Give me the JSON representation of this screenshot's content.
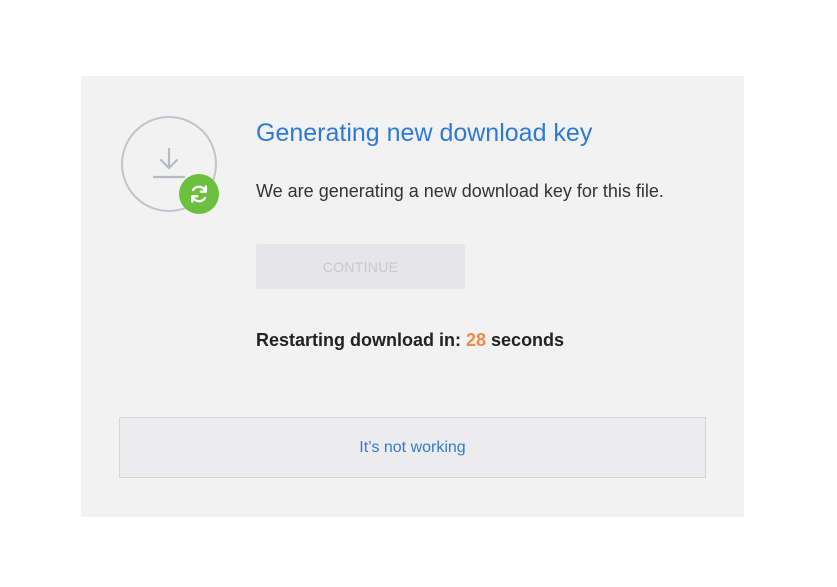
{
  "icons": {
    "download": "download-icon",
    "refresh": "refresh-icon"
  },
  "colors": {
    "accent": "#2f7ad6",
    "badge_green": "#6bc13e",
    "countdown_orange": "#f08b45",
    "card_bg": "#f2f2f2"
  },
  "dialog": {
    "title": "Generating new download key",
    "description": "We are generating a new download key for this file.",
    "continue_label": "CONTINUE",
    "restart_prefix": "Restarting download in: ",
    "countdown_value": "28",
    "restart_suffix": " seconds",
    "help_link": "It’s not working"
  }
}
